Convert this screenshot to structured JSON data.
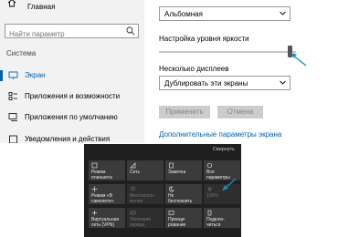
{
  "nav": {
    "home_label": "Главная",
    "search_placeholder": "Найти параметр",
    "section_title": "Система",
    "items": [
      {
        "label": "Экран",
        "icon": "monitor-icon",
        "selected": true
      },
      {
        "label": "Приложения и возможности",
        "icon": "apps-list-icon"
      },
      {
        "label": "Приложения по умолчанию",
        "icon": "default-apps-icon"
      },
      {
        "label": "Уведомления и действия",
        "icon": "notifications-icon"
      }
    ]
  },
  "display": {
    "orientation_value": "Альбомная",
    "brightness_label": "Настройка уровня яркости",
    "brightness_level_fraction": 0.95,
    "multiple_displays_label": "Несколько дисплеев",
    "multiple_displays_value": "Дублировать эти экраны",
    "apply_label": "Применить",
    "cancel_label": "Отмена",
    "advanced_link": "Дополнительные параметры экрана"
  },
  "action_center": {
    "collapse_label": "Свернуть",
    "tiles": [
      {
        "label": "Режим\nпланшета",
        "icon": "tablet-mode-icon",
        "enabled": true
      },
      {
        "label": "Сеть",
        "icon": "network-icon",
        "enabled": true
      },
      {
        "label": "Заметка",
        "icon": "note-icon",
        "enabled": true
      },
      {
        "label": "Все\nпараметры",
        "icon": "settings-gear-icon",
        "enabled": true
      },
      {
        "label": "Режим «В\nсамолете»",
        "icon": "airplane-icon",
        "enabled": true
      },
      {
        "label": "Местополо-\nжение",
        "icon": "location-icon",
        "enabled": false
      },
      {
        "label": "Не\nбеспокоить",
        "icon": "moon-icon",
        "enabled": true
      },
      {
        "label": "100%",
        "icon": "brightness-icon",
        "enabled": false
      },
      {
        "label": "Виртуальная\nсеть (VPN)",
        "icon": "vpn-icon",
        "enabled": true
      },
      {
        "label": "Экономия\nзаряда",
        "icon": "battery-saver-icon",
        "enabled": false
      },
      {
        "label": "Проеци-\nрование",
        "icon": "project-icon",
        "enabled": true
      },
      {
        "label": "Подклю-\nчиться",
        "icon": "connect-icon",
        "enabled": true
      }
    ]
  },
  "colors": {
    "accent": "#0063b1",
    "arrow": "#1a8fb8",
    "action_center_bg": "#1f1f1f",
    "tile_bg": "#3b3b3b"
  }
}
